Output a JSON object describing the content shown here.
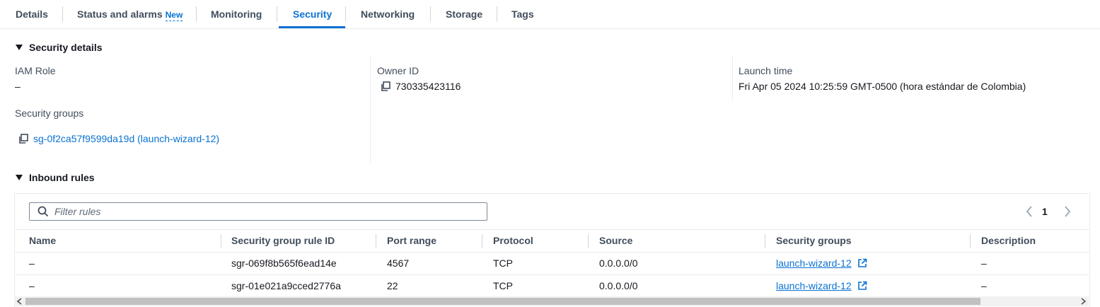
{
  "tabs": [
    {
      "label": "Details"
    },
    {
      "label": "Status and alarms",
      "badge": "New"
    },
    {
      "label": "Monitoring"
    },
    {
      "label": "Security"
    },
    {
      "label": "Networking"
    },
    {
      "label": "Storage"
    },
    {
      "label": "Tags"
    }
  ],
  "active_tab": "Security",
  "security_details": {
    "title": "Security details",
    "iam_role": {
      "label": "IAM Role",
      "value": "–"
    },
    "owner_id": {
      "label": "Owner ID",
      "value": "730335423116"
    },
    "launch_time": {
      "label": "Launch time",
      "value": "Fri Apr 05 2024 10:25:59 GMT-0500 (hora estándar de Colombia)"
    },
    "security_groups": {
      "label": "Security groups",
      "value": "sg-0f2ca57f9599da19d (launch-wizard-12)"
    }
  },
  "inbound_rules": {
    "title": "Inbound rules",
    "filter_placeholder": "Filter rules",
    "page": "1",
    "columns": [
      "Name",
      "Security group rule ID",
      "Port range",
      "Protocol",
      "Source",
      "Security groups",
      "Description"
    ],
    "rows": [
      {
        "name": "–",
        "rule_id": "sgr-069f8b565f6ead14e",
        "port_range": "4567",
        "protocol": "TCP",
        "source": "0.0.0.0/0",
        "security_group": "launch-wizard-12",
        "description": "–"
      },
      {
        "name": "–",
        "rule_id": "sgr-01e021a9cced2776a",
        "port_range": "22",
        "protocol": "TCP",
        "source": "0.0.0.0/0",
        "security_group": "launch-wizard-12",
        "description": "–"
      }
    ]
  },
  "colors": {
    "accent": "#0972d3",
    "text": "#16191f",
    "muted": "#414d5c",
    "border": "#e9ebed"
  },
  "icons": [
    "copy-icon",
    "external-link-icon",
    "caret-down-icon",
    "chevron-left-icon",
    "chevron-right-icon"
  ]
}
